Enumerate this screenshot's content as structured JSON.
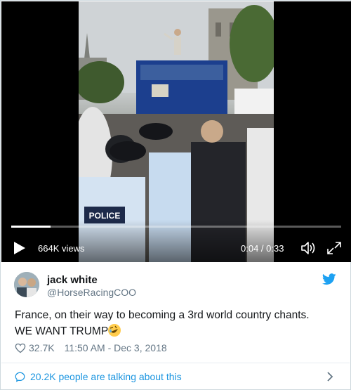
{
  "video": {
    "views": "664K views",
    "time": "0:04 / 0:33",
    "progress": 0.12,
    "icons": [
      "play-icon",
      "volume-icon",
      "fullscreen-icon"
    ]
  },
  "author": {
    "name": "jack white",
    "handle": "@HorseRacingCOO"
  },
  "tweet": {
    "line1": "France, on their way to becoming a 3rd world country chants.",
    "line2": "WE WANT TRUMP",
    "emoji": "rolling-on-floor-laughing-emoji"
  },
  "meta": {
    "likes": "32.7K",
    "datetime": "11:50 AM - Dec 3, 2018"
  },
  "footer": {
    "talking": "20.2K people are talking about this"
  },
  "colors": {
    "link": "#1b95e0",
    "secondary": "#657786",
    "text": "#14171a",
    "twitter_blue": "#1da1f2"
  }
}
